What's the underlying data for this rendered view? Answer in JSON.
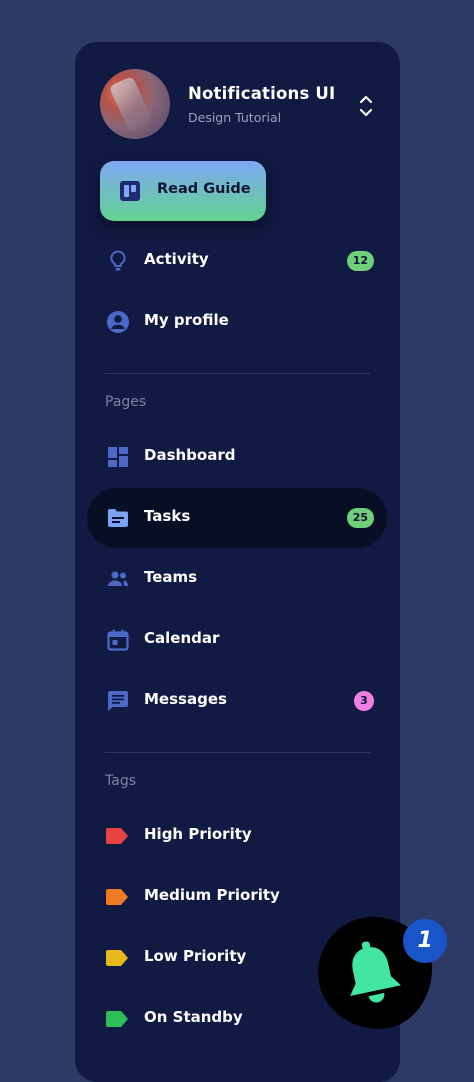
{
  "header": {
    "title": "Notifications UI",
    "subtitle": "Design Tutorial"
  },
  "guide_button": {
    "label": "Read Guide"
  },
  "top_items": [
    {
      "label": "Activity",
      "badge": "12",
      "badge_color": "#6fcf7a",
      "icon": "lightbulb-icon"
    },
    {
      "label": "My profile",
      "icon": "user-circle-icon"
    }
  ],
  "sections": {
    "pages": "Pages",
    "tags": "Tags"
  },
  "pages": [
    {
      "label": "Dashboard",
      "icon": "dashboard-icon"
    },
    {
      "label": "Tasks",
      "badge": "25",
      "badge_color": "#6fcf7a",
      "icon": "folder-icon",
      "active": true
    },
    {
      "label": "Teams",
      "icon": "people-icon"
    },
    {
      "label": "Calendar",
      "icon": "calendar-icon"
    },
    {
      "label": "Messages",
      "badge": "3",
      "badge_color": "#f07fe3",
      "icon": "message-icon"
    }
  ],
  "tags": [
    {
      "label": "High Priority",
      "color": "#e84343"
    },
    {
      "label": "Medium Priority",
      "color": "#f07a24"
    },
    {
      "label": "Low Priority",
      "color": "#e8b91c"
    },
    {
      "label": "On Standby",
      "color": "#2fbd5a"
    }
  ],
  "fab": {
    "badge": "1",
    "bell_color": "#43e6a1",
    "badge_color": "#1a54c9"
  },
  "colors": {
    "background": "#2e3a66",
    "panel": "#101a42",
    "icon": "#4e68c8",
    "accent_active": "#7aa2f5"
  }
}
